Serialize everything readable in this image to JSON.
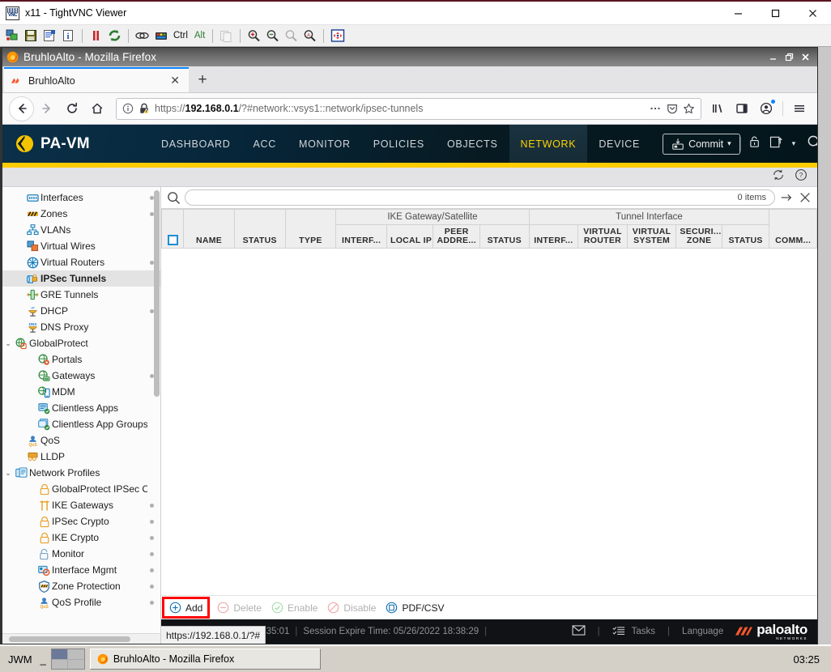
{
  "vnc": {
    "title": "x11 - TightVNC Viewer",
    "title_icon": "vnc-icon",
    "window_buttons": [
      "minimize",
      "maximize",
      "close"
    ],
    "toolbar": [
      {
        "name": "new-connection-icon",
        "label": ""
      },
      {
        "name": "save-connection-icon",
        "label": ""
      },
      {
        "name": "connection-options-icon",
        "label": ""
      },
      {
        "name": "connection-info-icon",
        "label": ""
      },
      {
        "name": "pause-icon",
        "label": ""
      },
      {
        "name": "refresh-icon",
        "label": ""
      },
      {
        "name": "send-ctrl-alt-del-icon",
        "label": ""
      },
      {
        "name": "send-keys-icon",
        "label": ""
      },
      {
        "name": "ctrl-key-button",
        "label": "Ctrl"
      },
      {
        "name": "alt-key-button",
        "label": "Alt"
      },
      {
        "name": "clipboard-transfer-icon",
        "label": ""
      },
      {
        "name": "zoom-in-icon",
        "label": ""
      },
      {
        "name": "zoom-out-icon",
        "label": ""
      },
      {
        "name": "zoom-100-icon",
        "label": ""
      },
      {
        "name": "zoom-auto-icon",
        "label": ""
      },
      {
        "name": "fullscreen-icon",
        "label": ""
      }
    ]
  },
  "firefox": {
    "window_title": "BruhloAlto - Mozilla Firefox",
    "tab": {
      "label": "BruhloAlto",
      "close_label": "✕",
      "newtab_label": "+"
    },
    "url": {
      "scheme": "https://",
      "host": "192.168.0.1",
      "path": "/?#network::vsys1::network/ipsec-tunnels",
      "full": "https://192.168.0.1/?#network::vsys1::network/ipsec-tunnels"
    },
    "nav_icons": [
      "back-icon",
      "forward-icon",
      "reload-icon",
      "home-icon"
    ],
    "url_icons": [
      "page-info-icon",
      "insecure-lock-warning-icon",
      "page-actions-icon",
      "pocket-icon",
      "bookmark-star-icon"
    ],
    "toolbar_icons": [
      "library-icon",
      "sidebar-icon",
      "account-icon",
      "hamburger-menu-icon"
    ]
  },
  "panos": {
    "product": "PA-VM",
    "logo_icon": "palo-alto-diamond-icon",
    "topnav": [
      {
        "label": "DASHBOARD",
        "active": false
      },
      {
        "label": "ACC",
        "active": false
      },
      {
        "label": "MONITOR",
        "active": false
      },
      {
        "label": "POLICIES",
        "active": false
      },
      {
        "label": "OBJECTS",
        "active": false
      },
      {
        "label": "NETWORK",
        "active": true
      },
      {
        "label": "DEVICE",
        "active": false
      }
    ],
    "commit_label": "Commit",
    "commit_icon": "commit-save-icon",
    "header_right_icons": [
      "config-lock-icon",
      "save-config-icon",
      "search-icon"
    ],
    "subbar_icons": [
      "refresh-icon",
      "help-icon"
    ],
    "accent_yellow": "#ffcc00",
    "header_dark": "#071a21",
    "sidebar": [
      {
        "label": "Interfaces",
        "icon": "interfaces-icon",
        "indent": 1,
        "dot": true,
        "caret": "",
        "selected": false
      },
      {
        "label": "Zones",
        "icon": "zones-icon",
        "indent": 1,
        "dot": true,
        "caret": "",
        "selected": false
      },
      {
        "label": "VLANs",
        "icon": "vlans-icon",
        "indent": 1,
        "dot": false,
        "caret": "",
        "selected": false
      },
      {
        "label": "Virtual Wires",
        "icon": "virtual-wires-icon",
        "indent": 1,
        "dot": false,
        "caret": "",
        "selected": false
      },
      {
        "label": "Virtual Routers",
        "icon": "virtual-routers-icon",
        "indent": 1,
        "dot": true,
        "caret": "",
        "selected": false
      },
      {
        "label": "IPSec Tunnels",
        "icon": "ipsec-tunnels-icon",
        "indent": 1,
        "dot": false,
        "caret": "",
        "selected": true
      },
      {
        "label": "GRE Tunnels",
        "icon": "gre-tunnels-icon",
        "indent": 1,
        "dot": false,
        "caret": "",
        "selected": false
      },
      {
        "label": "DHCP",
        "icon": "dhcp-icon",
        "indent": 1,
        "dot": true,
        "caret": "",
        "selected": false
      },
      {
        "label": "DNS Proxy",
        "icon": "dns-proxy-icon",
        "indent": 1,
        "dot": false,
        "caret": "",
        "selected": false
      },
      {
        "label": "GlobalProtect",
        "icon": "globalprotect-icon",
        "indent": 0,
        "dot": false,
        "caret": "⌄",
        "selected": false
      },
      {
        "label": "Portals",
        "icon": "portals-icon",
        "indent": 2,
        "dot": false,
        "caret": "",
        "selected": false
      },
      {
        "label": "Gateways",
        "icon": "gateways-icon",
        "indent": 2,
        "dot": true,
        "caret": "",
        "selected": false
      },
      {
        "label": "MDM",
        "icon": "mdm-icon",
        "indent": 2,
        "dot": false,
        "caret": "",
        "selected": false
      },
      {
        "label": "Clientless Apps",
        "icon": "clientless-apps-icon",
        "indent": 2,
        "dot": false,
        "caret": "",
        "selected": false
      },
      {
        "label": "Clientless App Groups",
        "icon": "clientless-app-groups-icon",
        "indent": 2,
        "dot": false,
        "caret": "",
        "selected": false
      },
      {
        "label": "QoS",
        "icon": "qos-icon",
        "indent": 1,
        "dot": false,
        "caret": "",
        "selected": false
      },
      {
        "label": "LLDP",
        "icon": "lldp-icon",
        "indent": 1,
        "dot": false,
        "caret": "",
        "selected": false
      },
      {
        "label": "Network Profiles",
        "icon": "network-profiles-icon",
        "indent": 0,
        "dot": false,
        "caret": "⌄",
        "selected": false
      },
      {
        "label": "GlobalProtect IPSec Cry",
        "icon": "lock-icon",
        "indent": 2,
        "dot": false,
        "caret": "",
        "selected": false
      },
      {
        "label": "IKE Gateways",
        "icon": "ike-gateways-icon",
        "indent": 2,
        "dot": true,
        "caret": "",
        "selected": false
      },
      {
        "label": "IPSec Crypto",
        "icon": "lock-icon",
        "indent": 2,
        "dot": true,
        "caret": "",
        "selected": false
      },
      {
        "label": "IKE Crypto",
        "icon": "lock-icon",
        "indent": 2,
        "dot": true,
        "caret": "",
        "selected": false
      },
      {
        "label": "Monitor",
        "icon": "monitor-profile-icon",
        "indent": 2,
        "dot": true,
        "caret": "",
        "selected": false
      },
      {
        "label": "Interface Mgmt",
        "icon": "interface-mgmt-icon",
        "indent": 2,
        "dot": true,
        "caret": "",
        "selected": false
      },
      {
        "label": "Zone Protection",
        "icon": "zone-protection-icon",
        "indent": 2,
        "dot": true,
        "caret": "",
        "selected": false
      },
      {
        "label": "QoS Profile",
        "icon": "qos-profile-icon",
        "indent": 2,
        "dot": true,
        "caret": "",
        "selected": false
      }
    ],
    "search": {
      "placeholder": "",
      "value": "",
      "items_count": "0 items",
      "icons": [
        "search-icon",
        "apply-filter-icon",
        "clear-filter-icon"
      ]
    },
    "table": {
      "group_headers": [
        {
          "label": "",
          "span": 4
        },
        {
          "label": "IKE Gateway/Satellite",
          "span": 4
        },
        {
          "label": "Tunnel Interface",
          "span": 5
        },
        {
          "label": "",
          "span": 1
        }
      ],
      "columns": [
        {
          "label": "",
          "kind": "checkbox"
        },
        {
          "label": "NAME"
        },
        {
          "label": "STATUS"
        },
        {
          "label": "TYPE"
        },
        {
          "label": "INTERF..."
        },
        {
          "label": "LOCAL IP"
        },
        {
          "label": "PEER ADDRE..."
        },
        {
          "label": "STATUS"
        },
        {
          "label": "INTERF..."
        },
        {
          "label": "VIRTUAL ROUTER"
        },
        {
          "label": "VIRTUAL SYSTEM"
        },
        {
          "label": "SECURI... ZONE"
        },
        {
          "label": "STATUS"
        },
        {
          "label": "COMM..."
        }
      ],
      "rows": []
    },
    "toolbar_actions": [
      {
        "label": "Add",
        "icon": "add-icon",
        "enabled": true,
        "highlighted": true
      },
      {
        "label": "Delete",
        "icon": "delete-icon",
        "enabled": false,
        "highlighted": false
      },
      {
        "label": "Enable",
        "icon": "enable-icon",
        "enabled": false,
        "highlighted": false
      },
      {
        "label": "Disable",
        "icon": "disable-icon",
        "enabled": false,
        "highlighted": false
      },
      {
        "label": "PDF/CSV",
        "icon": "pdf-csv-icon",
        "enabled": true,
        "highlighted": false
      }
    ],
    "statusbar": {
      "login_time": "n Time: 04/26/2022 18:35:01",
      "session_expire": "Session Expire Time: 05/26/2022 18:38:29",
      "tasks_label": "Tasks",
      "language_label": "Language",
      "message_icon": "envelope-icon",
      "tasks_icon": "tasks-icon",
      "brand_name": "paloalto",
      "brand_sub": "NETWORKS"
    },
    "link_tooltip": "https://192.168.0.1/?#"
  },
  "taskbar": {
    "wm_label": "JWM",
    "minimize_label": "_",
    "task_label": "BruhloAlto - Mozilla Firefox",
    "clock": "03:25"
  }
}
